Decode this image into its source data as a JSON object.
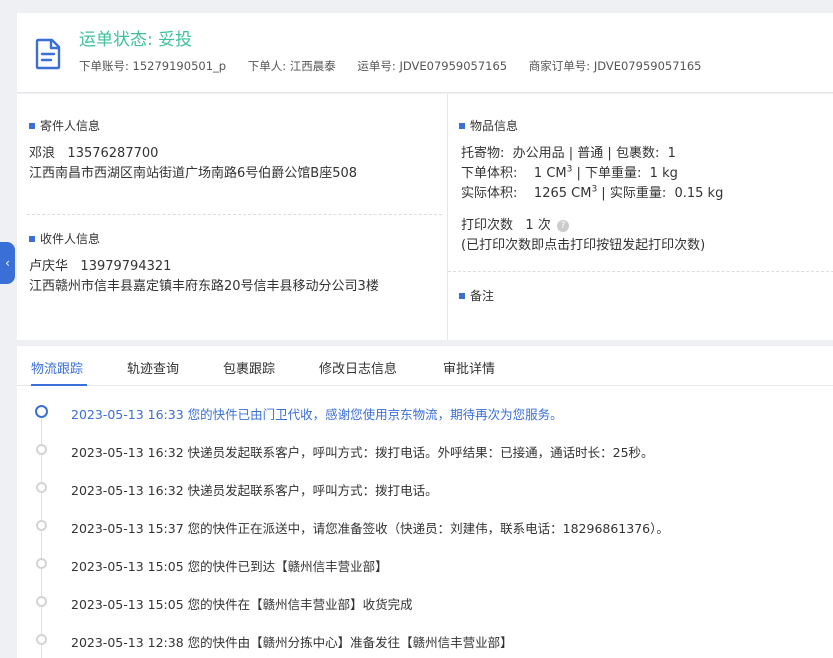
{
  "header": {
    "status_label": "运单状态: 妥投",
    "account_label": "下单账号:",
    "account_value": "15279190501_p",
    "orderer_label": "下单人:",
    "orderer_value": "江西晨泰",
    "waybill_label": "运单号:",
    "waybill_value": "JDVE07959057165",
    "merchant_label": "商家订单号:",
    "merchant_value": "JDVE07959057165"
  },
  "sender": {
    "title": "寄件人信息",
    "name": "邓浪",
    "phone": "13576287700",
    "address": "江西南昌市西湖区南站街道广场南路6号伯爵公馆B座508"
  },
  "receiver": {
    "title": "收件人信息",
    "name": "卢庆华",
    "phone": "13979794321",
    "address": "江西赣州市信丰县嘉定镇丰府东路20号信丰县移动分公司3楼"
  },
  "goods": {
    "title": "物品信息",
    "consign_label": "托寄物:",
    "consign_value": "办公用品 | 普通 | 包裹数:",
    "package_count": "1",
    "order_volume_label": "下单体积:",
    "order_volume_value": "1 CM",
    "order_weight_label": "下单重量:",
    "order_weight_value": "1 kg",
    "actual_volume_label": "实际体积:",
    "actual_volume_value": "1265 CM",
    "actual_weight_label": "实际重量:",
    "actual_weight_value": "0.15 kg",
    "cube": "3",
    "print_label": "打印次数",
    "print_value": "1 次",
    "print_hint": "(已打印次数即点击打印按钮发起打印次数)"
  },
  "remark": {
    "title": "备注"
  },
  "tabs": [
    "物流跟踪",
    "轨迹查询",
    "包裹跟踪",
    "修改日志信息",
    "审批详情"
  ],
  "events": [
    {
      "time": "2023-05-13 16:33",
      "text": "您的快件已由门卫代收，感谢您使用京东物流，期待再次为您服务。"
    },
    {
      "time": "2023-05-13 16:32",
      "text": "快递员发起联系客户，呼叫方式：拨打电话。外呼结果：已接通，通话时长：25秒。"
    },
    {
      "time": "2023-05-13 16:32",
      "text": "快递员发起联系客户，呼叫方式：拨打电话。"
    },
    {
      "time": "2023-05-13 15:37",
      "text": "您的快件正在派送中，请您准备签收（快递员：刘建伟，联系电话：18296861376）。"
    },
    {
      "time": "2023-05-13 15:05",
      "text": "您的快件已到达【赣州信丰营业部】"
    },
    {
      "time": "2023-05-13 15:05",
      "text": "您的快件在【赣州信丰营业部】收货完成"
    },
    {
      "time": "2023-05-13 12:38",
      "text": "您的快件由【赣州分拣中心】准备发往【赣州信丰营业部】"
    }
  ],
  "icons": {
    "document": "document-icon",
    "collapse": "chevron-left-icon",
    "help": "question-icon"
  },
  "colors": {
    "accent": "#3a6fd8",
    "status": "#3cc39a"
  }
}
